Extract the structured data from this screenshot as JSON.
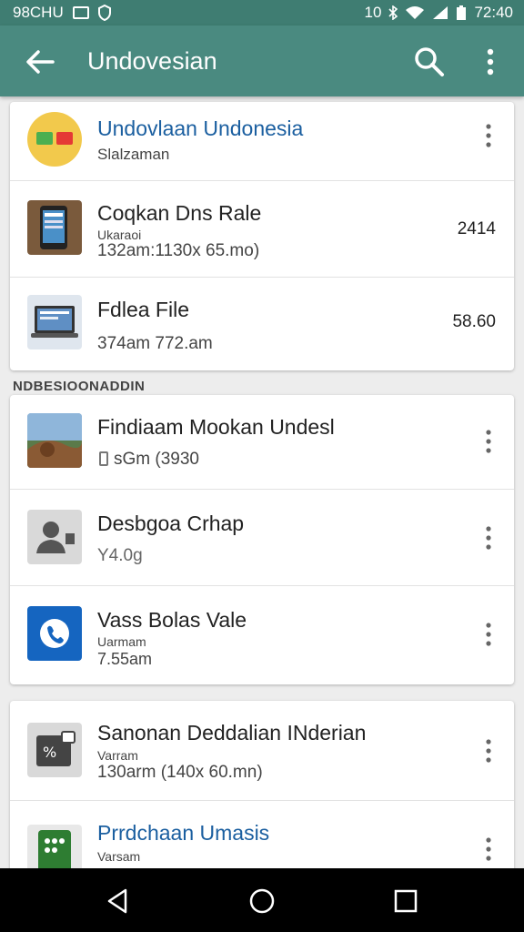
{
  "status_bar": {
    "left_text": "98CHU",
    "right_text": "10",
    "time": "72:40"
  },
  "app_bar": {
    "title": "Undovesian"
  },
  "card1": {
    "items": [
      {
        "title": "Undovlaan Undonesia",
        "subtitle": "Slalzaman"
      },
      {
        "title": "Coqkan Dns Rale",
        "subtitle": "Ukaraoi",
        "detail": "132am:1130x 65.mo)",
        "meta": "2414"
      },
      {
        "title": "Fdlea File",
        "detail": "374am 772.am",
        "meta": "58.60"
      }
    ]
  },
  "section_header": "NDBESIOONADDIN",
  "card2": {
    "items": [
      {
        "title": "Findiaam Mookan Undesl",
        "detail": "sGm (3930"
      },
      {
        "title": "Desbgoa Crhap",
        "detail": "Y4.0g"
      },
      {
        "title": "Vass Bolas Vale",
        "subtitle": "Uarmam",
        "detail": "7.55am"
      }
    ]
  },
  "card3": {
    "items": [
      {
        "title": "Sanonan Deddalian INderian",
        "subtitle": "Varram",
        "detail": "130arm (140x 60.mn)"
      },
      {
        "title": "Prrdchaan Umasis",
        "subtitle": "Varsam"
      }
    ]
  },
  "icons": {
    "back": "arrow-back-icon",
    "search": "search-icon",
    "overflow": "more-vertical-icon"
  },
  "colors": {
    "appbar": "#4a8a80",
    "statusbar": "#3f7d72",
    "accent_title": "#1b5fa0"
  }
}
